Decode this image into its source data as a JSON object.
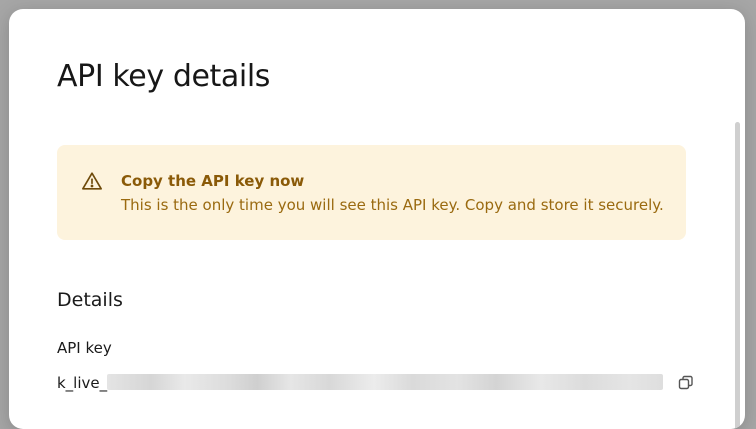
{
  "dialog": {
    "title": "API key details"
  },
  "alert": {
    "icon": "warning-triangle-icon",
    "title": "Copy the API key now",
    "message": "This is the only time you will see this API key. Copy and store it securely.",
    "background_color": "#fdf3dd",
    "text_color": "#8a5a08"
  },
  "details": {
    "heading": "Details",
    "api_key_label": "API key",
    "api_key_visible_prefix": "k_live_",
    "copy_icon": "copy-icon"
  }
}
